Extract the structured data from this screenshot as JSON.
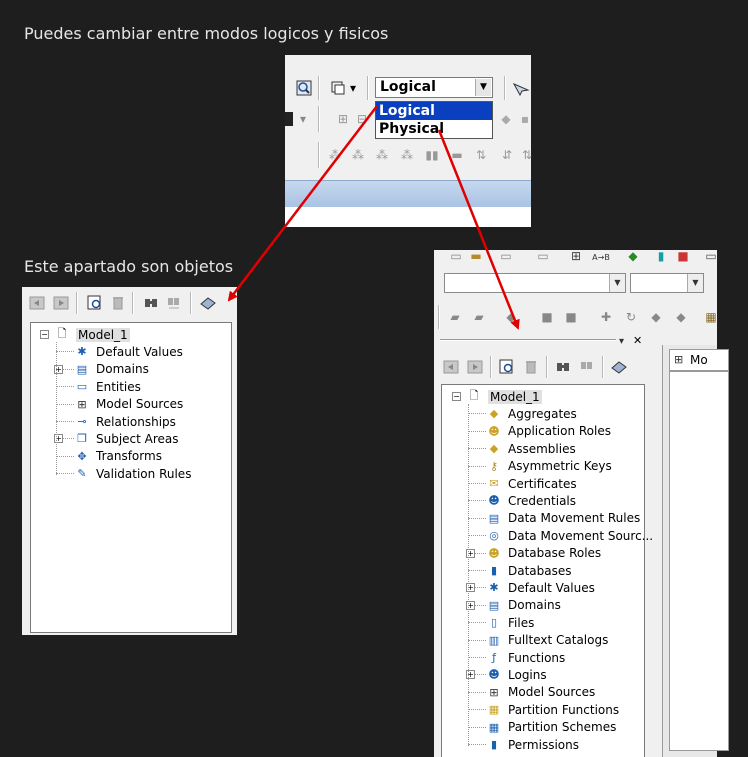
{
  "captions": {
    "top": "Puedes cambiar entre modos logicos y fisicos",
    "left": "Este apartado son objetos"
  },
  "mode_selector": {
    "current_value": "Logical",
    "options": [
      "Logical",
      "Physical"
    ],
    "highlighted": "Logical"
  },
  "left_tree": {
    "root": "Model_1",
    "items": [
      {
        "label": "Default Values",
        "icon": "default-values-icon",
        "expandable": false
      },
      {
        "label": "Domains",
        "icon": "domains-icon",
        "expandable": true
      },
      {
        "label": "Entities",
        "icon": "entities-icon",
        "expandable": false
      },
      {
        "label": "Model Sources",
        "icon": "model-sources-icon",
        "expandable": false
      },
      {
        "label": "Relationships",
        "icon": "relationships-icon",
        "expandable": false
      },
      {
        "label": "Subject Areas",
        "icon": "subject-areas-icon",
        "expandable": true
      },
      {
        "label": "Transforms",
        "icon": "transforms-icon",
        "expandable": false
      },
      {
        "label": "Validation Rules",
        "icon": "validation-rules-icon",
        "expandable": false
      }
    ]
  },
  "right_tree": {
    "root": "Model_1",
    "items": [
      {
        "label": "Aggregates",
        "icon": "aggregates-icon",
        "expandable": false
      },
      {
        "label": "Application Roles",
        "icon": "application-roles-icon",
        "expandable": false
      },
      {
        "label": "Assemblies",
        "icon": "assemblies-icon",
        "expandable": false
      },
      {
        "label": "Asymmetric Keys",
        "icon": "asymmetric-keys-icon",
        "expandable": false
      },
      {
        "label": "Certificates",
        "icon": "certificates-icon",
        "expandable": false
      },
      {
        "label": "Credentials",
        "icon": "credentials-icon",
        "expandable": false
      },
      {
        "label": "Data Movement Rules",
        "icon": "data-movement-rules-icon",
        "expandable": false
      },
      {
        "label": "Data Movement Sourc...",
        "icon": "data-movement-sources-icon",
        "expandable": false
      },
      {
        "label": "Database Roles",
        "icon": "database-roles-icon",
        "expandable": true
      },
      {
        "label": "Databases",
        "icon": "databases-icon",
        "expandable": false
      },
      {
        "label": "Default Values",
        "icon": "default-values-icon",
        "expandable": true
      },
      {
        "label": "Domains",
        "icon": "domains-icon",
        "expandable": true
      },
      {
        "label": "Files",
        "icon": "files-icon",
        "expandable": false
      },
      {
        "label": "Fulltext Catalogs",
        "icon": "fulltext-catalogs-icon",
        "expandable": false
      },
      {
        "label": "Functions",
        "icon": "functions-icon",
        "expandable": false
      },
      {
        "label": "Logins",
        "icon": "logins-icon",
        "expandable": true
      },
      {
        "label": "Model Sources",
        "icon": "model-sources-icon",
        "expandable": false
      },
      {
        "label": "Partition Functions",
        "icon": "partition-functions-icon",
        "expandable": false
      },
      {
        "label": "Partition Schemes",
        "icon": "partition-schemes-icon",
        "expandable": false
      },
      {
        "label": "Permissions",
        "icon": "permissions-icon",
        "expandable": false
      }
    ]
  },
  "doc_tab": {
    "label": "Mo"
  },
  "colors": {
    "background": "#1e1e1e",
    "arrow": "#e00000",
    "selection": "#0a3fbf"
  }
}
